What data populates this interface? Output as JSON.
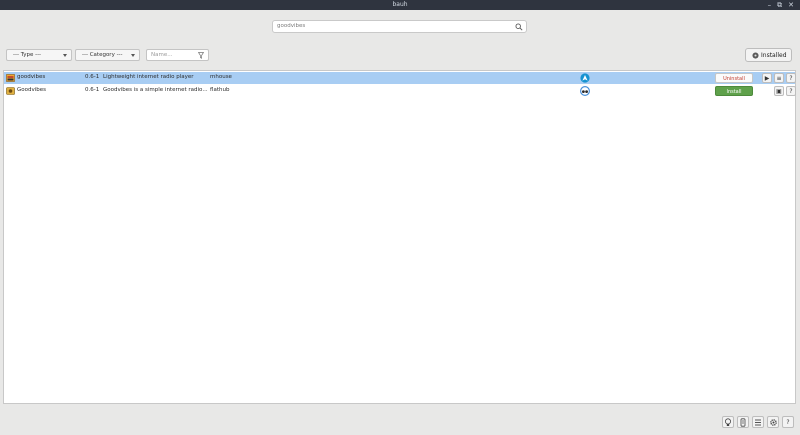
{
  "window": {
    "title": "bauh",
    "controls": [
      "–",
      "⧉",
      "✕"
    ]
  },
  "search": {
    "value": "goodvibes",
    "icon": "search-icon"
  },
  "filters": {
    "type_label": "--- Type ---",
    "category_label": "--- Category ---",
    "name_placeholder": "Name..."
  },
  "installed_button": {
    "label": "Installed"
  },
  "packages": [
    {
      "name": "goodvibes",
      "version": "0.6-1",
      "description": "Lightweight internet radio player",
      "repository": "mhouse",
      "action_label": "Uninstall",
      "selected": true
    },
    {
      "name": "Goodvibes",
      "version": "0.6-1",
      "description": "Goodvibes is a simple internet radio...",
      "repository": "flathub",
      "action_label": "Install",
      "selected": false
    }
  ],
  "row_actions": {
    "run": "▶",
    "info": "≡",
    "help": "?",
    "screenshot": "▣"
  },
  "bottom_bar": {
    "help": "?"
  },
  "colors": {
    "titlebar": "#2f343f",
    "selected_row": "#a8cdf3",
    "install": "#5fa14b",
    "uninstall_text": "#c0392b",
    "arch_blue": "#1793d1"
  }
}
